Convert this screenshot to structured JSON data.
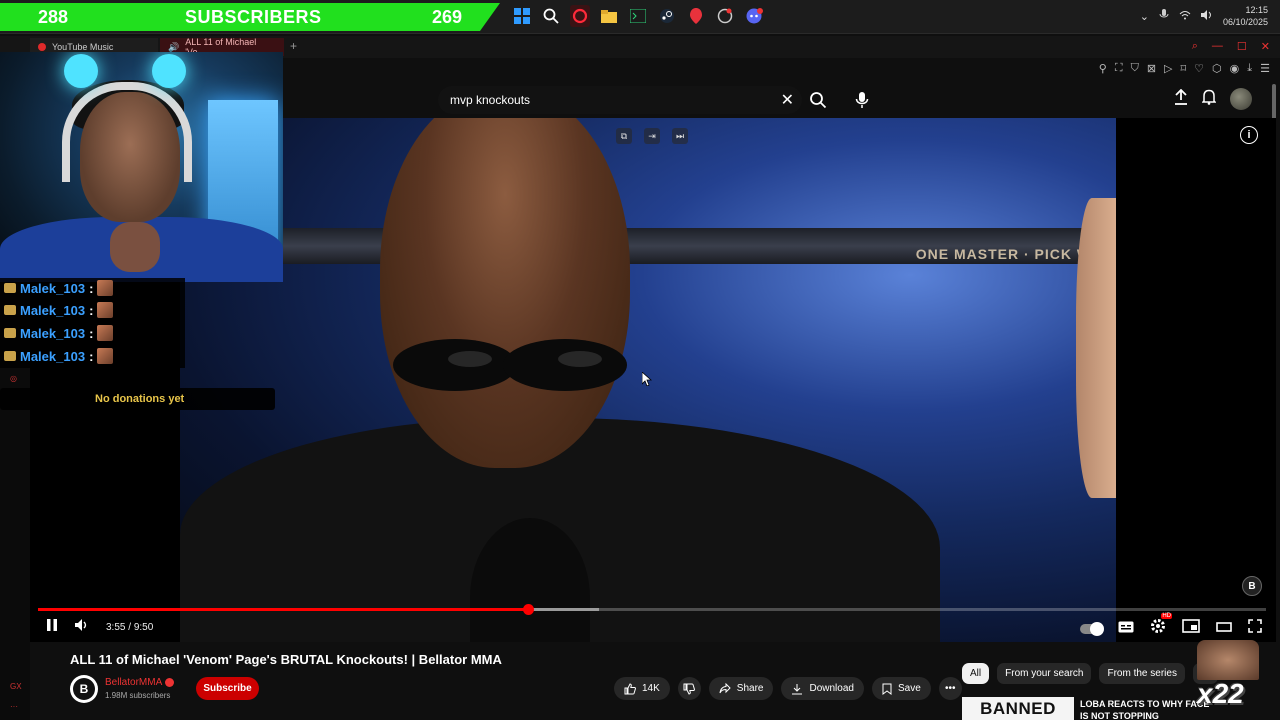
{
  "overlay": {
    "subs_left": "288",
    "subs_label": "SUBSCRIBERS",
    "subs_right": "269",
    "chat": [
      {
        "user": "Malek_103",
        "sep": ":"
      },
      {
        "user": "Malek_103",
        "sep": ":"
      },
      {
        "user": "Malek_103",
        "sep": ":"
      },
      {
        "user": "Malek_103",
        "sep": ":"
      }
    ],
    "donations": "No donations yet",
    "combo_multiplier": "x22",
    "sidebar_label": "GX"
  },
  "taskbar": {
    "time": "12:15",
    "date": "06/10/2025",
    "accent": "#21e01e"
  },
  "browser": {
    "tabs": [
      {
        "label": "YouTube Music"
      },
      {
        "label": "ALL 11 of Michael 'Ve..."
      }
    ]
  },
  "search": {
    "query": "mvp knockouts"
  },
  "player": {
    "current_time": "3:55",
    "separator": "/",
    "duration": "9:50",
    "played_fraction": 0.399,
    "loaded_fraction": 0.457,
    "cage_banner": "ONE MASTER · PICK WI"
  },
  "video": {
    "title": "ALL 11 of Michael 'Venom' Page's BRUTAL Knockouts! | Bellator MMA",
    "channel": "BellatorMMA",
    "subscribers": "1.98M subscribers",
    "subscribe_label": "Subscribe",
    "likes": "14K",
    "share_label": "Share",
    "download_label": "Download",
    "save_label": "Save"
  },
  "related": {
    "chips": [
      "All",
      "From your search",
      "From the series",
      "Fr"
    ],
    "thumb_text": "BANNED",
    "title": "LOBA REACTS TO WHY FACE IS NOT STOPPING CHEATERS"
  }
}
